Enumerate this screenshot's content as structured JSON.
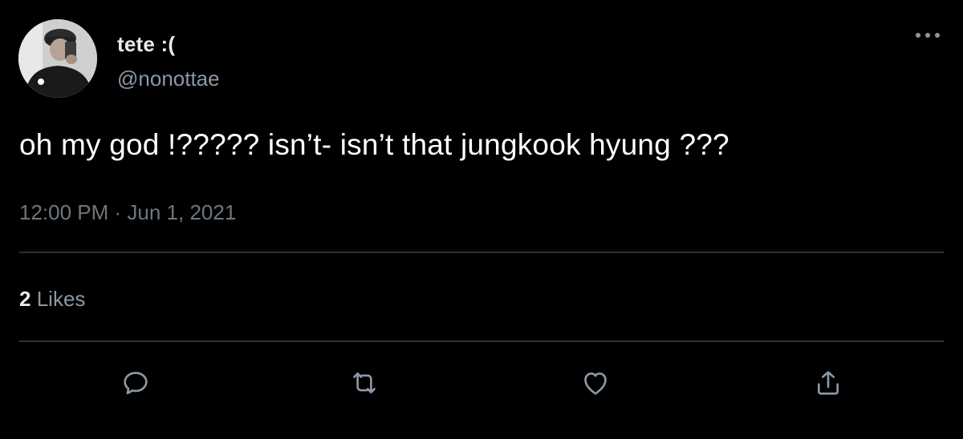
{
  "author": {
    "display_name": "tete :(",
    "handle": "@nonottae"
  },
  "tweet": {
    "text": "oh my god !????? isn’t- isn’t that jungkook hyung ???",
    "timestamp": "12:00 PM · Jun 1, 2021"
  },
  "stats": {
    "likes_count": "2",
    "likes_label": "Likes"
  },
  "actions": {
    "reply_icon": "reply-icon",
    "retweet_icon": "retweet-icon",
    "like_icon": "heart-icon",
    "share_icon": "share-icon",
    "more_icon": "more-icon"
  },
  "colors": {
    "background": "#000000",
    "primary_text": "#e7e9ea",
    "secondary_text": "#8b98a5",
    "icon": "#8b98a5",
    "divider": "#2f3336"
  }
}
